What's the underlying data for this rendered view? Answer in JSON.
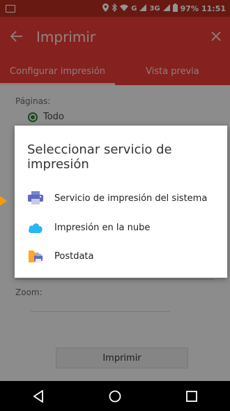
{
  "status_bar": {
    "battery": "97%",
    "time": "11:51",
    "network_1": "G",
    "network_2": "3G"
  },
  "app_bar": {
    "title": "Imprimir"
  },
  "tabs": [
    {
      "label": "Configurar impresión",
      "active": true
    },
    {
      "label": "Vista previa",
      "active": false
    }
  ],
  "content": {
    "pages_label": "Páginas:",
    "option_all": "Todo",
    "zoom_label": "Zoom:",
    "print_button": "Imprimir"
  },
  "dialog": {
    "title": "Seleccionar servicio de impresión",
    "services": [
      {
        "label": "Servicio de impresión del sistema",
        "icon": "printer-icon",
        "color": "#5c6bc0"
      },
      {
        "label": "Impresión en la nube",
        "icon": "cloud-icon",
        "color": "#29b6f6"
      },
      {
        "label": "Postdata",
        "icon": "folder-printer-icon",
        "color": "#ffa726"
      }
    ]
  },
  "colors": {
    "primary": "#e53935",
    "status": "#b32b20",
    "accent": "#2e7d32"
  }
}
